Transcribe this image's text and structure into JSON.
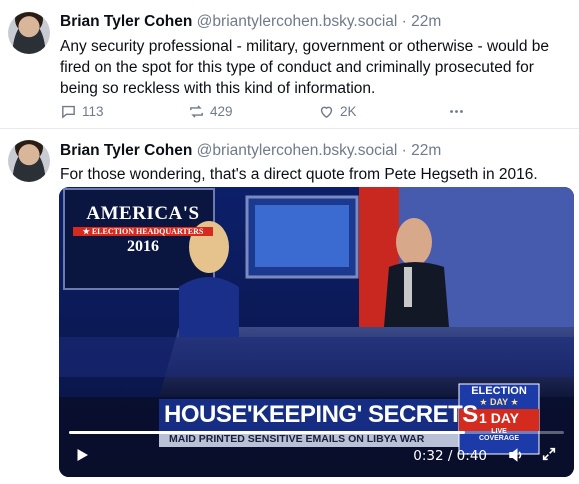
{
  "posts": [
    {
      "author": "Brian Tyler Cohen",
      "handle": "@briantylercohen.bsky.social",
      "separator": " · ",
      "time": "22m",
      "text": "Any security professional - military, government or otherwise - would be fired on the spot for this type of conduct and criminally prosecuted for being so reckless with this kind of information.",
      "actions": {
        "replies": "113",
        "reposts": "429",
        "likes": "2K"
      }
    },
    {
      "author": "Brian Tyler Cohen",
      "handle": "@briantylercohen.bsky.social",
      "separator": " · ",
      "time": "22m",
      "text": "For those wondering, that's a direct quote from Pete Hegseth in 2016."
    }
  ],
  "video": {
    "logo_line1": "AMERICA'S",
    "logo_line2": "★ ELECTION HEADQUARTERS",
    "logo_year": "2016",
    "headline": "HOUSE'KEEPING' SECRETS",
    "subheadline": "MAID PRINTED SENSITIVE EMAILS ON LIBYA WAR",
    "badge_top": "ELECTION",
    "badge_day": "★ DAY ★",
    "badge_count": "1 DAY",
    "badge_live1": "LIVE",
    "badge_live2": "COVERAGE",
    "time_display": "0:32 / 0:40",
    "progress": 0.8,
    "icons": {
      "play": "play-icon",
      "volume": "volume-icon",
      "fullscreen": "fullscreen-icon"
    }
  },
  "colors": {
    "handle": "#6f7b8a",
    "text": "#0b0f14",
    "accent_red": "#d52b1e",
    "studio_blue": "#1c3aa8"
  }
}
